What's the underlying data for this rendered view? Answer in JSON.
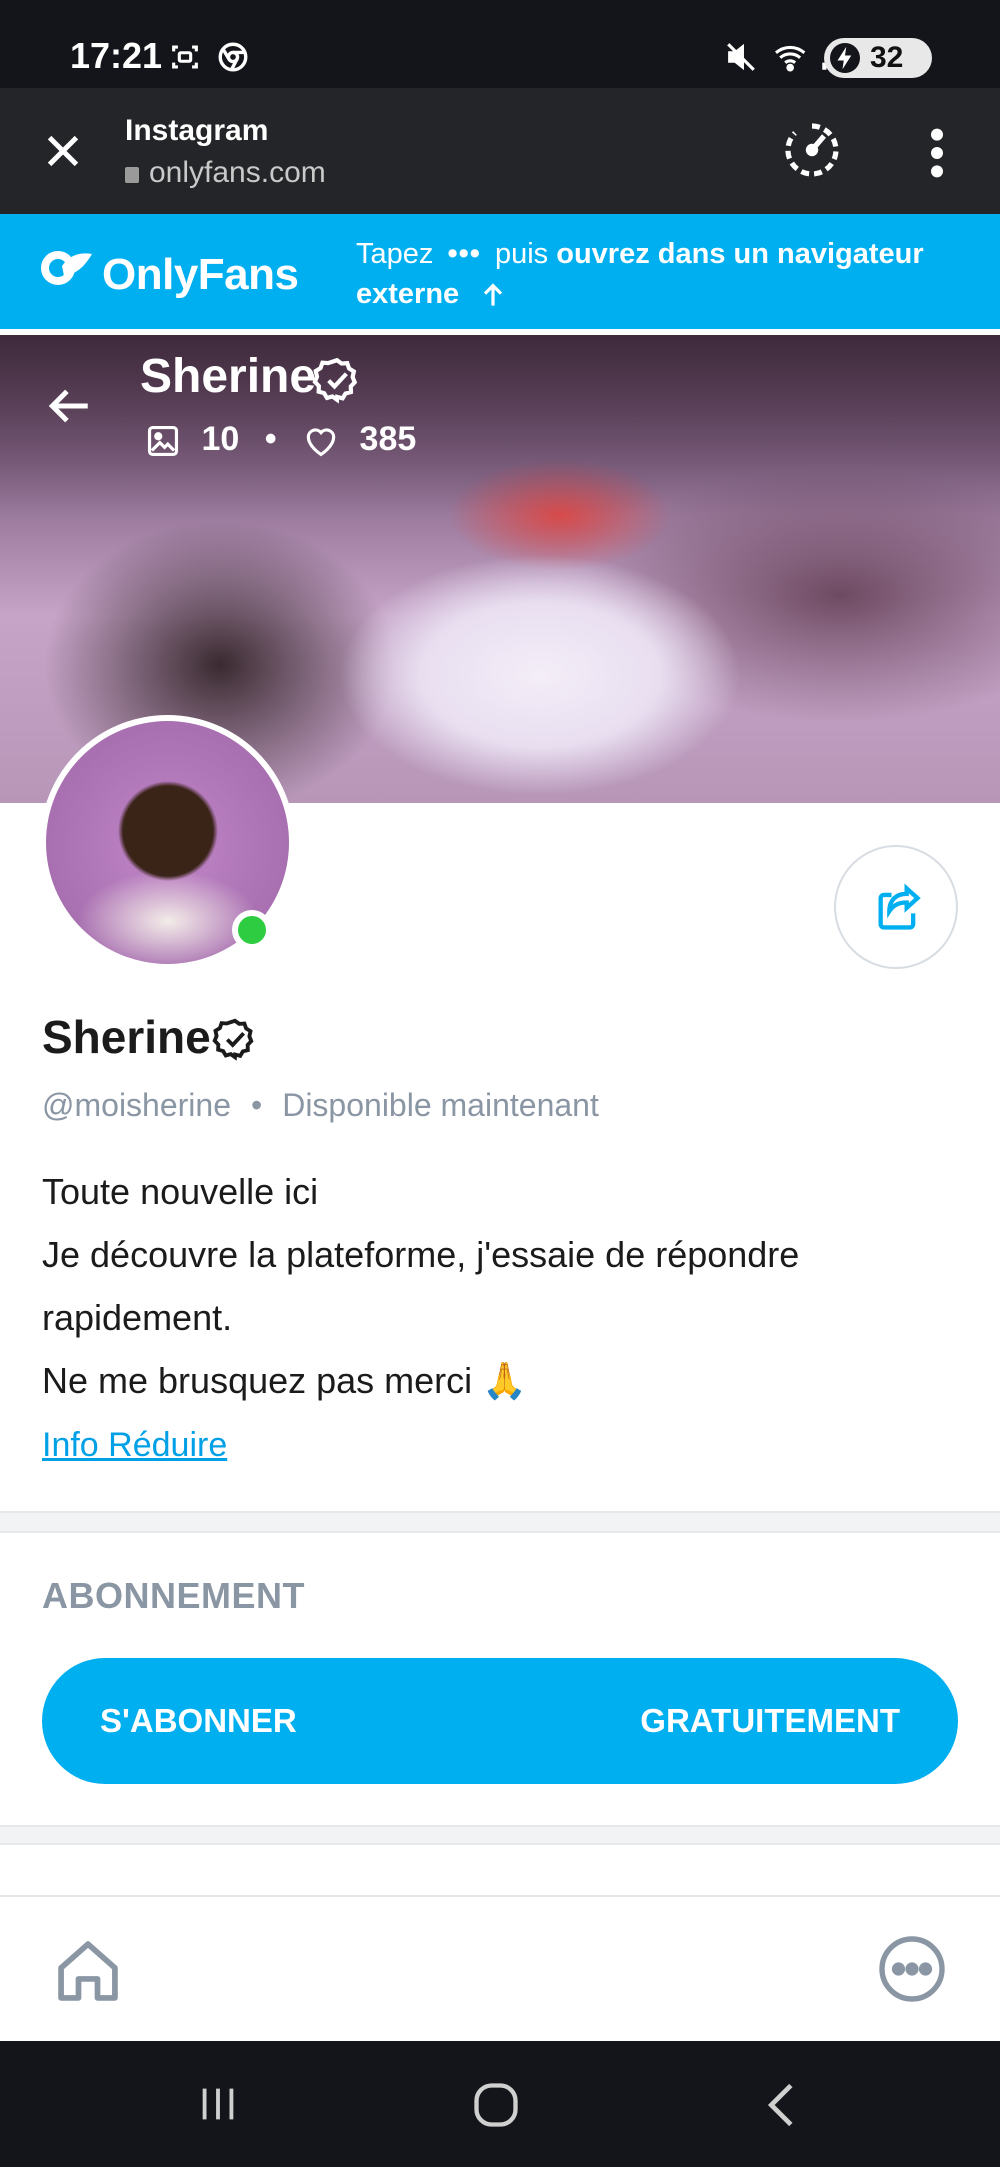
{
  "status_bar": {
    "time": "17:21",
    "battery": "32",
    "icons": [
      "screenshot-icon",
      "chrome-icon",
      "mute-icon",
      "wifi-icon",
      "signal-icon",
      "battery-icon"
    ]
  },
  "browser": {
    "title": "Instagram",
    "url": "onlyfans.com",
    "icons": [
      "close-icon",
      "lock-icon",
      "speed-icon",
      "more-vert-icon"
    ]
  },
  "banner": {
    "logo_text": "OnlyFans",
    "hint_prefix": "Tapez",
    "hint_dots": "•••",
    "hint_middle": "puis",
    "hint_bold": "ouvrez dans un navigateur externe"
  },
  "cover": {
    "name": "Sherine",
    "posts_count": "10",
    "likes_count": "385",
    "separator": "•"
  },
  "profile": {
    "name": "Sherine",
    "handle": "@moisherine",
    "separator": "•",
    "status": "Disponible maintenant",
    "bio_lines": [
      "Toute nouvelle ici",
      "Je découvre la plateforme, j'essaie de répondre rapidement.",
      "Ne me brusquez pas merci 🙏"
    ],
    "info_link": "Info Réduire",
    "online": true
  },
  "subscription": {
    "heading": "ABONNEMENT",
    "button_left": "S'ABONNER",
    "button_right": "GRATUITEMENT"
  },
  "colors": {
    "brand": "#00aff0",
    "online": "#2ecc40",
    "muted": "#8a96a3",
    "dark_bar": "#232528"
  }
}
